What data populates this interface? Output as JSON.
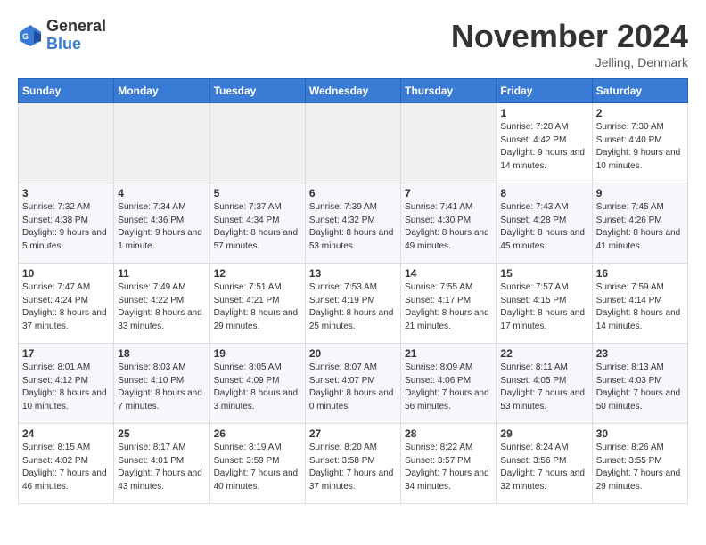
{
  "logo": {
    "general": "General",
    "blue": "Blue"
  },
  "title": "November 2024",
  "location": "Jelling, Denmark",
  "days_of_week": [
    "Sunday",
    "Monday",
    "Tuesday",
    "Wednesday",
    "Thursday",
    "Friday",
    "Saturday"
  ],
  "weeks": [
    [
      {
        "day": "",
        "content": ""
      },
      {
        "day": "",
        "content": ""
      },
      {
        "day": "",
        "content": ""
      },
      {
        "day": "",
        "content": ""
      },
      {
        "day": "",
        "content": ""
      },
      {
        "day": "1",
        "content": "Sunrise: 7:28 AM\nSunset: 4:42 PM\nDaylight: 9 hours and 14 minutes."
      },
      {
        "day": "2",
        "content": "Sunrise: 7:30 AM\nSunset: 4:40 PM\nDaylight: 9 hours and 10 minutes."
      }
    ],
    [
      {
        "day": "3",
        "content": "Sunrise: 7:32 AM\nSunset: 4:38 PM\nDaylight: 9 hours and 5 minutes."
      },
      {
        "day": "4",
        "content": "Sunrise: 7:34 AM\nSunset: 4:36 PM\nDaylight: 9 hours and 1 minute."
      },
      {
        "day": "5",
        "content": "Sunrise: 7:37 AM\nSunset: 4:34 PM\nDaylight: 8 hours and 57 minutes."
      },
      {
        "day": "6",
        "content": "Sunrise: 7:39 AM\nSunset: 4:32 PM\nDaylight: 8 hours and 53 minutes."
      },
      {
        "day": "7",
        "content": "Sunrise: 7:41 AM\nSunset: 4:30 PM\nDaylight: 8 hours and 49 minutes."
      },
      {
        "day": "8",
        "content": "Sunrise: 7:43 AM\nSunset: 4:28 PM\nDaylight: 8 hours and 45 minutes."
      },
      {
        "day": "9",
        "content": "Sunrise: 7:45 AM\nSunset: 4:26 PM\nDaylight: 8 hours and 41 minutes."
      }
    ],
    [
      {
        "day": "10",
        "content": "Sunrise: 7:47 AM\nSunset: 4:24 PM\nDaylight: 8 hours and 37 minutes."
      },
      {
        "day": "11",
        "content": "Sunrise: 7:49 AM\nSunset: 4:22 PM\nDaylight: 8 hours and 33 minutes."
      },
      {
        "day": "12",
        "content": "Sunrise: 7:51 AM\nSunset: 4:21 PM\nDaylight: 8 hours and 29 minutes."
      },
      {
        "day": "13",
        "content": "Sunrise: 7:53 AM\nSunset: 4:19 PM\nDaylight: 8 hours and 25 minutes."
      },
      {
        "day": "14",
        "content": "Sunrise: 7:55 AM\nSunset: 4:17 PM\nDaylight: 8 hours and 21 minutes."
      },
      {
        "day": "15",
        "content": "Sunrise: 7:57 AM\nSunset: 4:15 PM\nDaylight: 8 hours and 17 minutes."
      },
      {
        "day": "16",
        "content": "Sunrise: 7:59 AM\nSunset: 4:14 PM\nDaylight: 8 hours and 14 minutes."
      }
    ],
    [
      {
        "day": "17",
        "content": "Sunrise: 8:01 AM\nSunset: 4:12 PM\nDaylight: 8 hours and 10 minutes."
      },
      {
        "day": "18",
        "content": "Sunrise: 8:03 AM\nSunset: 4:10 PM\nDaylight: 8 hours and 7 minutes."
      },
      {
        "day": "19",
        "content": "Sunrise: 8:05 AM\nSunset: 4:09 PM\nDaylight: 8 hours and 3 minutes."
      },
      {
        "day": "20",
        "content": "Sunrise: 8:07 AM\nSunset: 4:07 PM\nDaylight: 8 hours and 0 minutes."
      },
      {
        "day": "21",
        "content": "Sunrise: 8:09 AM\nSunset: 4:06 PM\nDaylight: 7 hours and 56 minutes."
      },
      {
        "day": "22",
        "content": "Sunrise: 8:11 AM\nSunset: 4:05 PM\nDaylight: 7 hours and 53 minutes."
      },
      {
        "day": "23",
        "content": "Sunrise: 8:13 AM\nSunset: 4:03 PM\nDaylight: 7 hours and 50 minutes."
      }
    ],
    [
      {
        "day": "24",
        "content": "Sunrise: 8:15 AM\nSunset: 4:02 PM\nDaylight: 7 hours and 46 minutes."
      },
      {
        "day": "25",
        "content": "Sunrise: 8:17 AM\nSunset: 4:01 PM\nDaylight: 7 hours and 43 minutes."
      },
      {
        "day": "26",
        "content": "Sunrise: 8:19 AM\nSunset: 3:59 PM\nDaylight: 7 hours and 40 minutes."
      },
      {
        "day": "27",
        "content": "Sunrise: 8:20 AM\nSunset: 3:58 PM\nDaylight: 7 hours and 37 minutes."
      },
      {
        "day": "28",
        "content": "Sunrise: 8:22 AM\nSunset: 3:57 PM\nDaylight: 7 hours and 34 minutes."
      },
      {
        "day": "29",
        "content": "Sunrise: 8:24 AM\nSunset: 3:56 PM\nDaylight: 7 hours and 32 minutes."
      },
      {
        "day": "30",
        "content": "Sunrise: 8:26 AM\nSunset: 3:55 PM\nDaylight: 7 hours and 29 minutes."
      }
    ]
  ]
}
